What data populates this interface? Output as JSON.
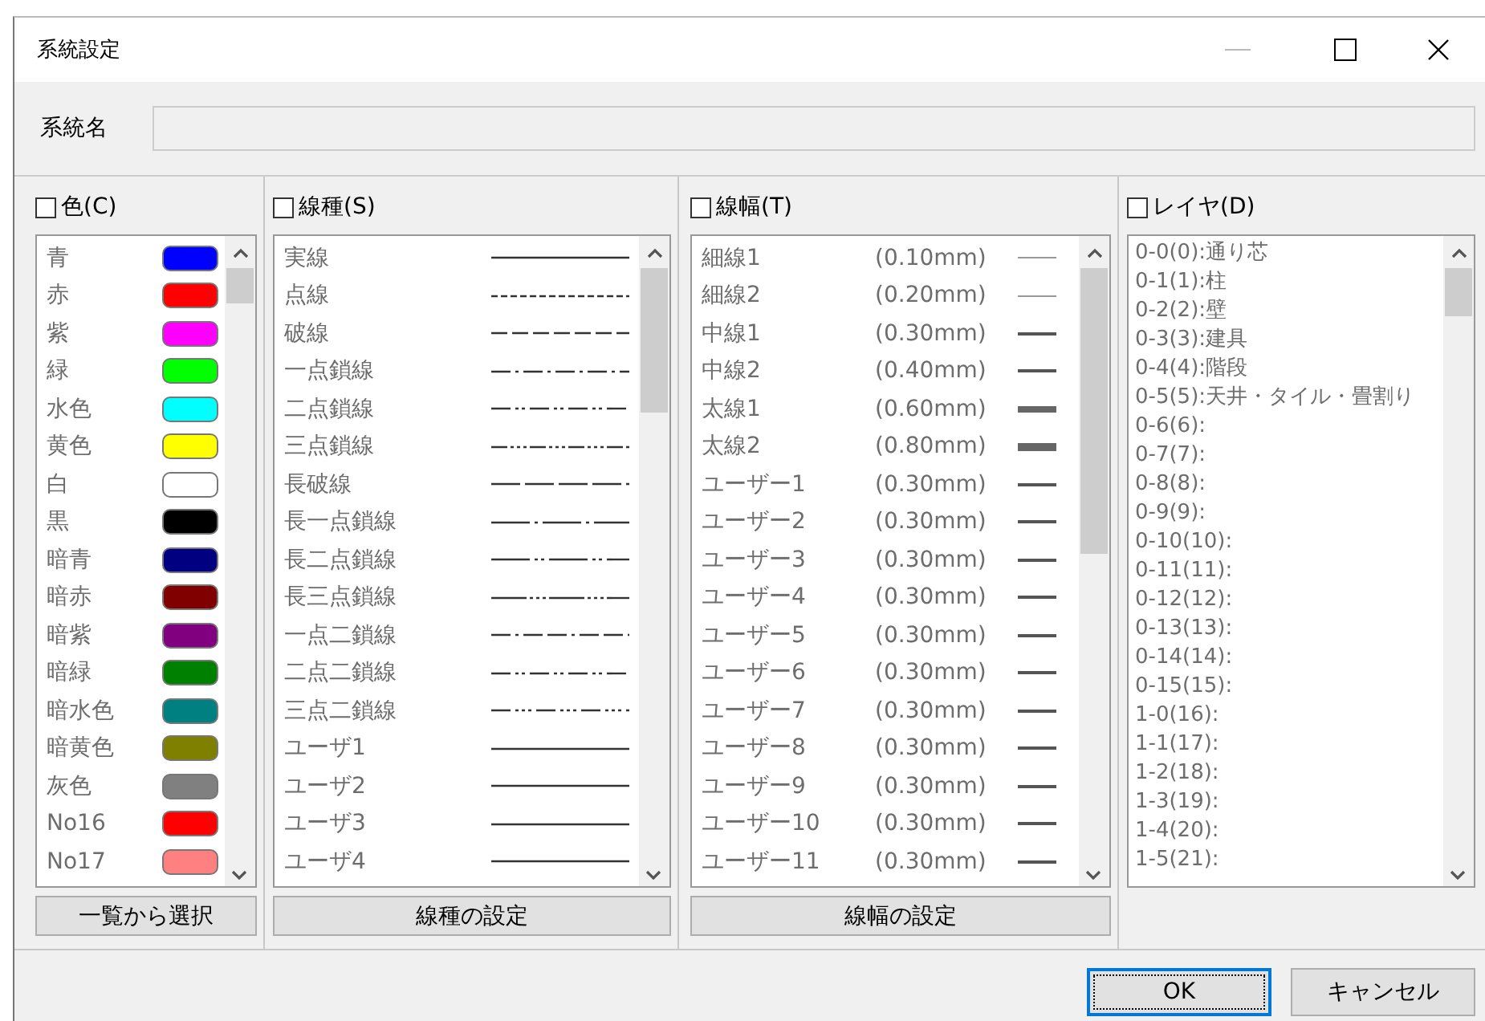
{
  "window": {
    "title": "系統設定"
  },
  "name_field": {
    "label": "系統名"
  },
  "color_panel": {
    "label": "色(C)",
    "checked": false,
    "button": "一覧から選択",
    "items": [
      {
        "name": "青",
        "color": "#0000ff"
      },
      {
        "name": "赤",
        "color": "#ff0000"
      },
      {
        "name": "紫",
        "color": "#ff00ff"
      },
      {
        "name": "緑",
        "color": "#00ff00"
      },
      {
        "name": "水色",
        "color": "#00ffff"
      },
      {
        "name": "黄色",
        "color": "#ffff00"
      },
      {
        "name": "白",
        "color": "#ffffff"
      },
      {
        "name": "黒",
        "color": "#000000"
      },
      {
        "name": "暗青",
        "color": "#000080"
      },
      {
        "name": "暗赤",
        "color": "#800000"
      },
      {
        "name": "暗紫",
        "color": "#800080"
      },
      {
        "name": "暗緑",
        "color": "#008000"
      },
      {
        "name": "暗水色",
        "color": "#008080"
      },
      {
        "name": "暗黄色",
        "color": "#808000"
      },
      {
        "name": "灰色",
        "color": "#808080"
      },
      {
        "name": "No16",
        "color": "#ff0000"
      },
      {
        "name": "No17",
        "color": "#ff8080"
      }
    ]
  },
  "linetype_panel": {
    "label": "線種(S)",
    "checked": false,
    "button": "線種の設定",
    "items": [
      {
        "name": "実線",
        "kind": "solid"
      },
      {
        "name": "点線",
        "kind": "dotted"
      },
      {
        "name": "破線",
        "kind": "dashed"
      },
      {
        "name": "一点鎖線",
        "kind": "dashdot"
      },
      {
        "name": "二点鎖線",
        "kind": "dashdotdot"
      },
      {
        "name": "三点鎖線",
        "kind": "dashdotdotdot"
      },
      {
        "name": "長破線",
        "kind": "longdash"
      },
      {
        "name": "長一点鎖線",
        "kind": "longdashdot"
      },
      {
        "name": "長二点鎖線",
        "kind": "longdashdotdot"
      },
      {
        "name": "長三点鎖線",
        "kind": "longdashdotdotdot"
      },
      {
        "name": "一点二鎖線",
        "kind": "dashdot2"
      },
      {
        "name": "二点二鎖線",
        "kind": "dashdotdot2"
      },
      {
        "name": "三点二鎖線",
        "kind": "dashdotdotdot2"
      },
      {
        "name": "ユーザ1",
        "kind": "solid"
      },
      {
        "name": "ユーザ2",
        "kind": "solid"
      },
      {
        "name": "ユーザ3",
        "kind": "solid"
      },
      {
        "name": "ユーザ4",
        "kind": "solid"
      }
    ]
  },
  "linewidth_panel": {
    "label": "線幅(T)",
    "checked": false,
    "button": "線幅の設定",
    "items": [
      {
        "name": "細線1",
        "width": "(0.10mm)",
        "kind": "hairline"
      },
      {
        "name": "細線2",
        "width": "(0.20mm)",
        "kind": "hairline"
      },
      {
        "name": "中線1",
        "width": "(0.30mm)",
        "kind": "medium"
      },
      {
        "name": "中線2",
        "width": "(0.40mm)",
        "kind": "medium"
      },
      {
        "name": "太線1",
        "width": "(0.60mm)",
        "kind": "bold"
      },
      {
        "name": "太線2",
        "width": "(0.80mm)",
        "kind": "heavy"
      },
      {
        "name": "ユーザー1",
        "width": "(0.30mm)",
        "kind": "medium"
      },
      {
        "name": "ユーザー2",
        "width": "(0.30mm)",
        "kind": "medium"
      },
      {
        "name": "ユーザー3",
        "width": "(0.30mm)",
        "kind": "medium"
      },
      {
        "name": "ユーザー4",
        "width": "(0.30mm)",
        "kind": "medium"
      },
      {
        "name": "ユーザー5",
        "width": "(0.30mm)",
        "kind": "medium"
      },
      {
        "name": "ユーザー6",
        "width": "(0.30mm)",
        "kind": "medium"
      },
      {
        "name": "ユーザー7",
        "width": "(0.30mm)",
        "kind": "medium"
      },
      {
        "name": "ユーザー8",
        "width": "(0.30mm)",
        "kind": "medium"
      },
      {
        "name": "ユーザー9",
        "width": "(0.30mm)",
        "kind": "medium"
      },
      {
        "name": "ユーザー10",
        "width": "(0.30mm)",
        "kind": "medium"
      },
      {
        "name": "ユーザー11",
        "width": "(0.30mm)",
        "kind": "medium"
      }
    ]
  },
  "layer_panel": {
    "label": "レイヤ(D)",
    "checked": false,
    "items": [
      "0-0(0):通り芯",
      "0-1(1):柱",
      "0-2(2):壁",
      "0-3(3):建具",
      "0-4(4):階段",
      "0-5(5):天井・タイル・畳割り",
      "0-6(6):",
      "0-7(7):",
      "0-8(8):",
      "0-9(9):",
      "0-10(10):",
      "0-11(11):",
      "0-12(12):",
      "0-13(13):",
      "0-14(14):",
      "0-15(15):",
      "1-0(16):",
      "1-1(17):",
      "1-2(18):",
      "1-3(19):",
      "1-4(20):",
      "1-5(21):"
    ]
  },
  "buttons": [
    {
      "label": "OK",
      "kind": "default"
    },
    {
      "label": "キャンセル",
      "kind": "normal"
    }
  ]
}
